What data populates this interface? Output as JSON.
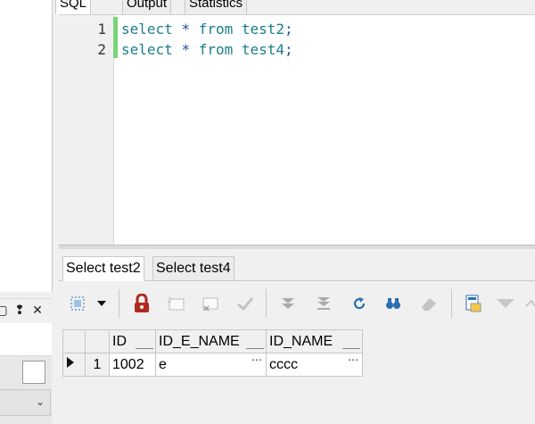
{
  "tabs": [
    "SQL",
    "Output",
    "Statistics"
  ],
  "editor": {
    "line_numbers": [
      "1",
      "2"
    ],
    "lines": [
      "select * from test2;",
      "select * from test4;"
    ]
  },
  "result_tabs": [
    "Select test2",
    "Select test4"
  ],
  "toolbar_icons": [
    "select-rows-icon",
    "dropdown-arrow-icon",
    "lock-icon",
    "insert-row-icon",
    "delete-row-icon",
    "confirm-icon",
    "next-page-icon",
    "last-page-icon",
    "refresh-icon",
    "find-icon",
    "eraser-icon",
    "export-icon",
    "filter-icon"
  ],
  "left_panel": {
    "window_buttons": [
      "restore-icon",
      "pin-icon",
      "close-icon"
    ]
  },
  "grid": {
    "columns": [
      "ID",
      "ID_E_NAME",
      "ID_NAME"
    ],
    "rows": [
      {
        "num": "1",
        "ID": "1002",
        "ID_E_NAME": "e",
        "ID_NAME": "cccc"
      }
    ]
  },
  "colors": {
    "keyword": "#1a7e8a",
    "line_marker": "#78d478",
    "lock": "#b2271f"
  }
}
